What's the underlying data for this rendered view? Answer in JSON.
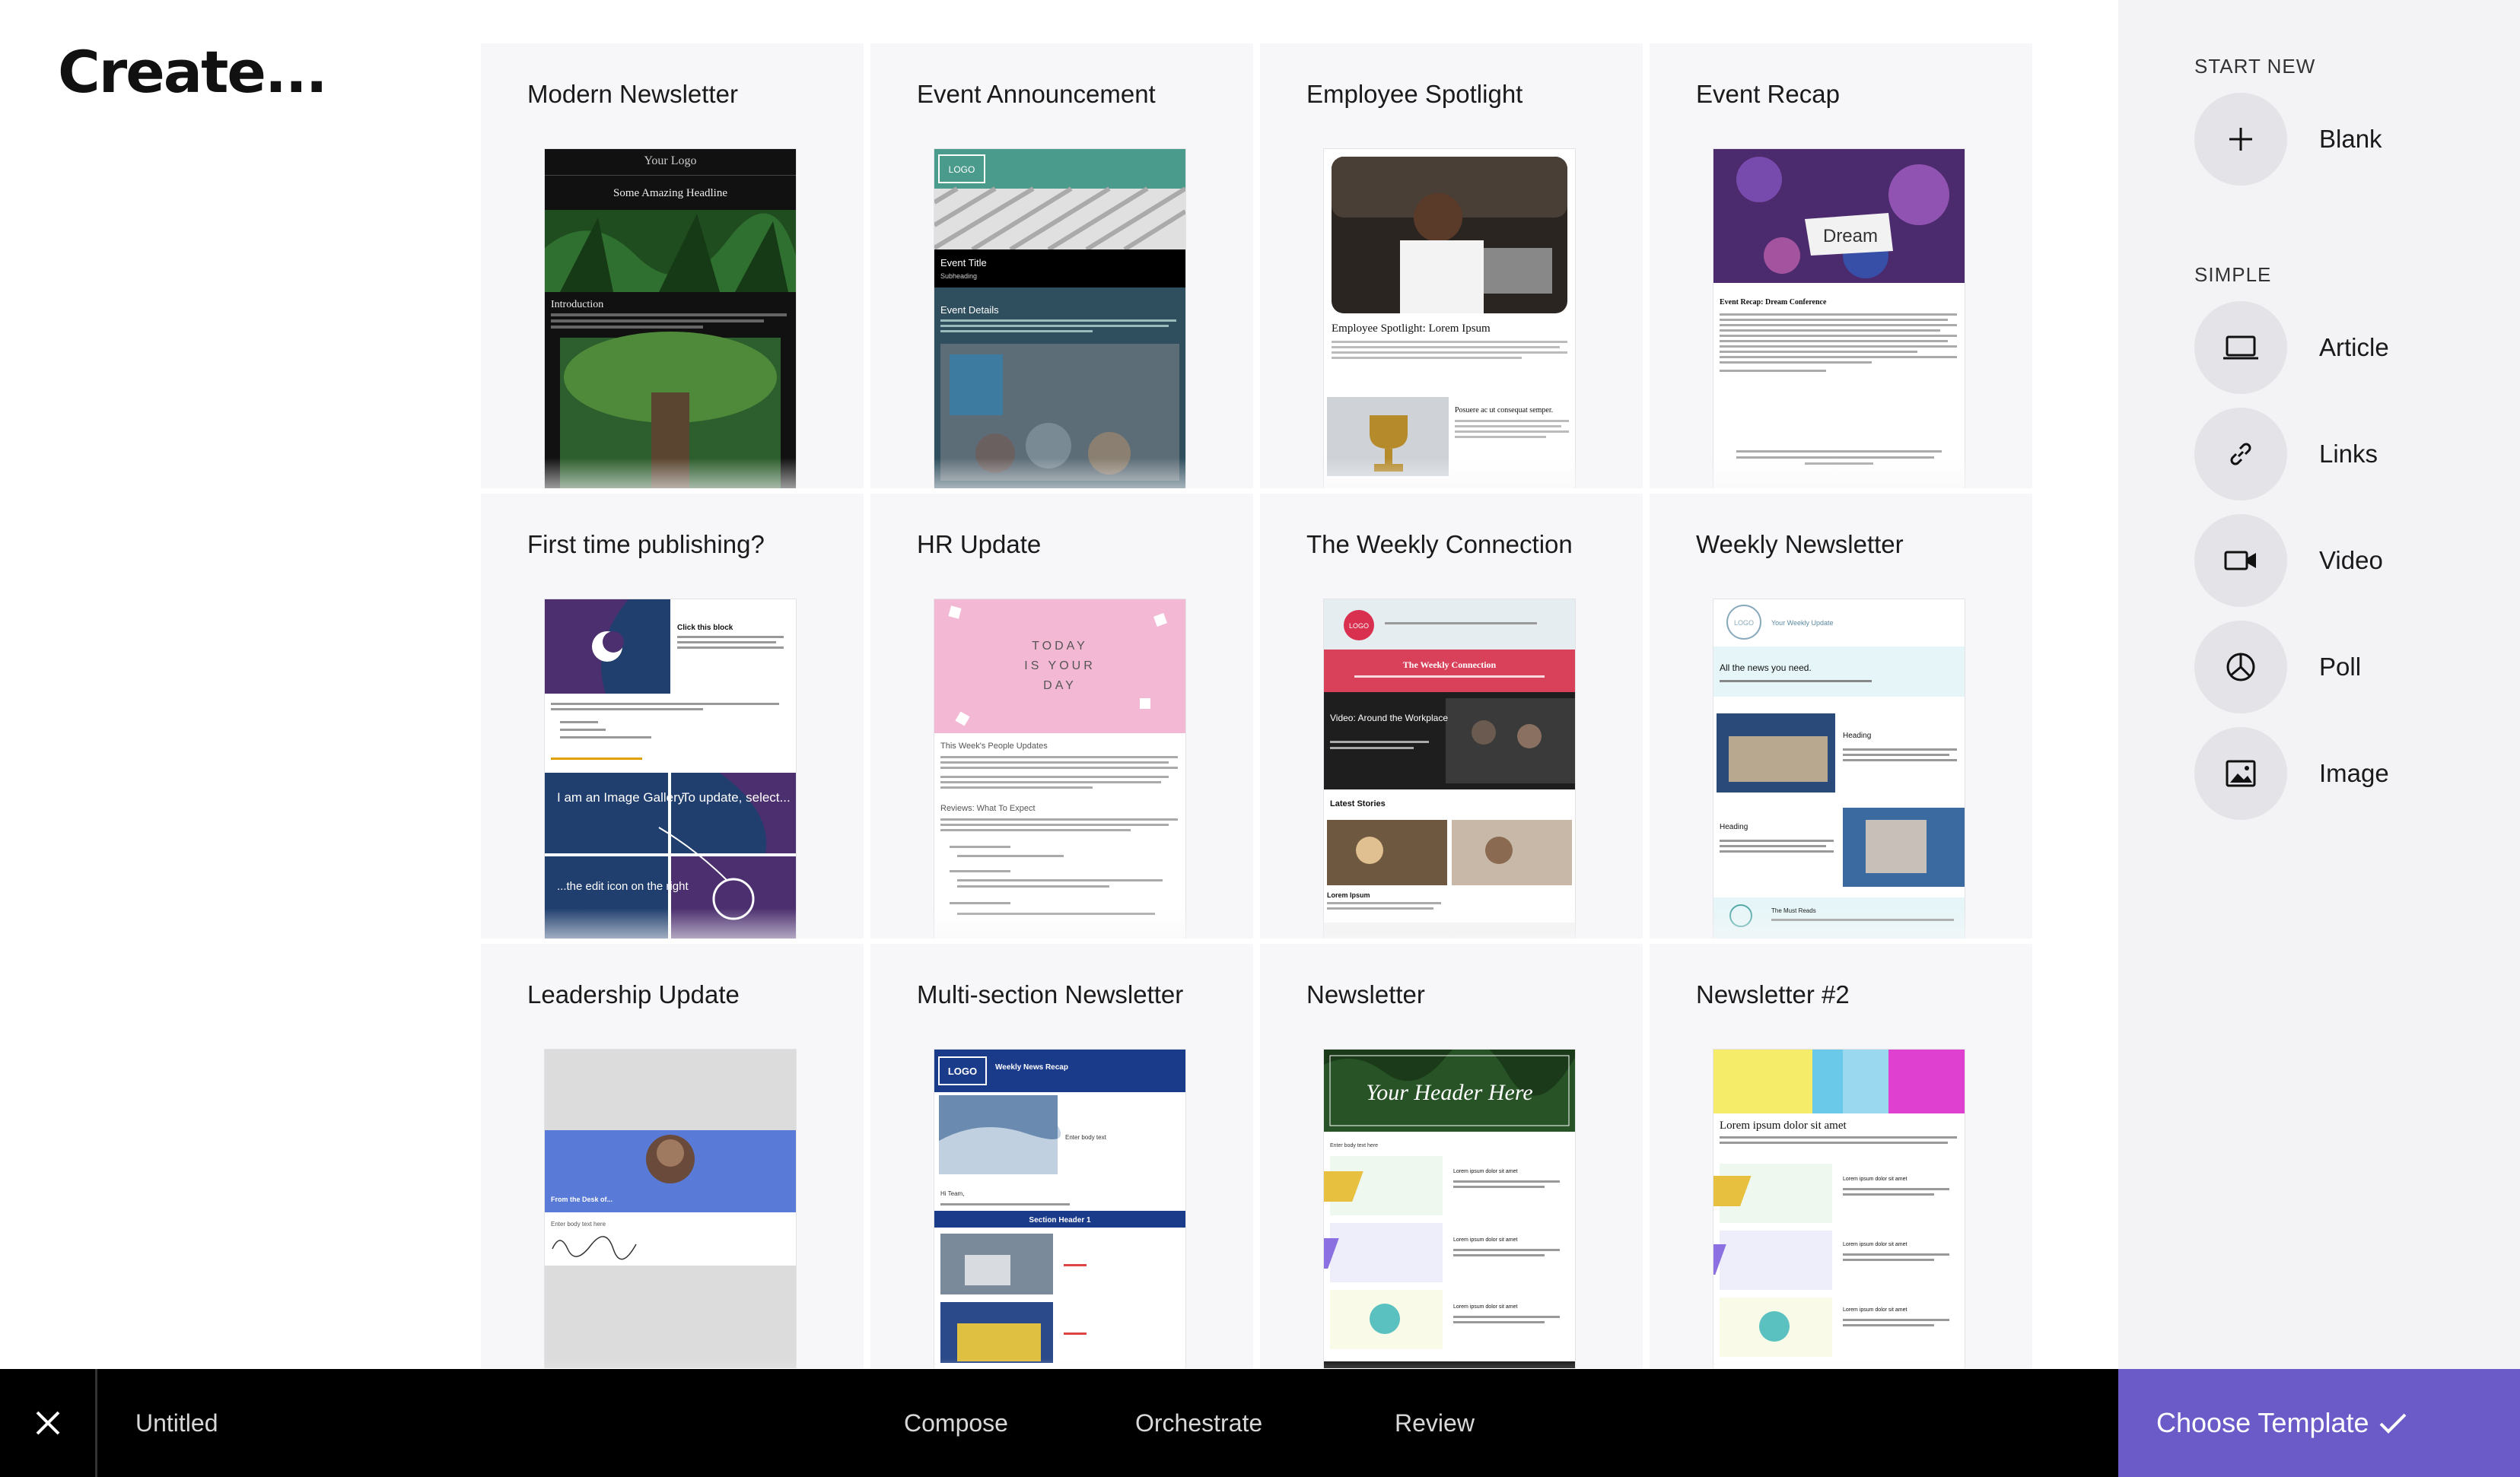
{
  "page": {
    "title": "Create..."
  },
  "templates": [
    {
      "label": "Modern Newsletter"
    },
    {
      "label": "Event Announcement"
    },
    {
      "label": "Employee Spotlight"
    },
    {
      "label": "Event Recap"
    },
    {
      "label": "First time publishing?"
    },
    {
      "label": "HR Update"
    },
    {
      "label": "The Weekly Connection"
    },
    {
      "label": "Weekly Newsletter"
    },
    {
      "label": "Leadership Update"
    },
    {
      "label": "Multi-section Newsletter"
    },
    {
      "label": "Newsletter"
    },
    {
      "label": "Newsletter #2"
    }
  ],
  "thumb_text": {
    "modern_logo": "Your Logo",
    "modern_headline": "Some Amazing Headline",
    "modern_intro": "Introduction",
    "event_logo": "LOGO",
    "event_title": "Event Title",
    "event_subheading": "Subheading",
    "event_details": "Event Details",
    "spotlight_title": "Employee Spotlight: Lorem Ipsum",
    "spotlight_sub": "Posuere ac ut consequat semper.",
    "recap_dream": "Dream",
    "recap_title": "Event Recap: Dream Conference",
    "first_click": "Click this block",
    "first_gallery": "I am an Image Gallery",
    "first_update": "To update, select...",
    "first_edit": "...the edit icon on the right",
    "hr_today": "TODAY",
    "hr_is": "IS YOUR",
    "hr_day": "DAY",
    "hr_people": "This Week's People Updates",
    "hr_reviews": "Reviews: What To Expect",
    "weekly_conn_logo": "LOGO",
    "weekly_conn_title": "The Weekly Connection",
    "weekly_conn_video": "Video: Around the Workplace",
    "weekly_conn_latest": "Latest Stories",
    "weekly_conn_lorem": "Lorem Ipsum",
    "wn_logo": "LOGO",
    "wn_title": "Your Weekly Update",
    "wn_all": "All the news you need.",
    "wn_heading": "Heading",
    "wn_must": "The Must Reads",
    "lead_from": "From the Desk of...",
    "lead_body": "Enter body text here",
    "multi_logo": "LOGO",
    "multi_title": "Weekly News Recap",
    "multi_body": "Enter body text",
    "multi_hi": "Hi Team,",
    "multi_section": "Section Header 1",
    "news_header": "Your Header Here",
    "news_body": "Enter body text here",
    "news_lorem": "Lorem ipsum dolor sit amet",
    "n2_title": "Lorem ipsum dolor sit amet",
    "n2_item": "Lorem ipsum dolor sit amet"
  },
  "sidebar": {
    "start_new_title": "START NEW",
    "blank": {
      "label": "Blank",
      "icon": "plus-icon"
    },
    "simple_title": "SIMPLE",
    "options": [
      {
        "label": "Article",
        "icon": "laptop-icon"
      },
      {
        "label": "Links",
        "icon": "link-icon"
      },
      {
        "label": "Video",
        "icon": "video-icon"
      },
      {
        "label": "Poll",
        "icon": "poll-icon"
      },
      {
        "label": "Image",
        "icon": "image-icon"
      }
    ]
  },
  "bottombar": {
    "doc_title": "Untitled",
    "steps": [
      "Compose",
      "Orchestrate",
      "Review"
    ],
    "choose_label": "Choose Template",
    "accent": "#6a5bc8"
  }
}
